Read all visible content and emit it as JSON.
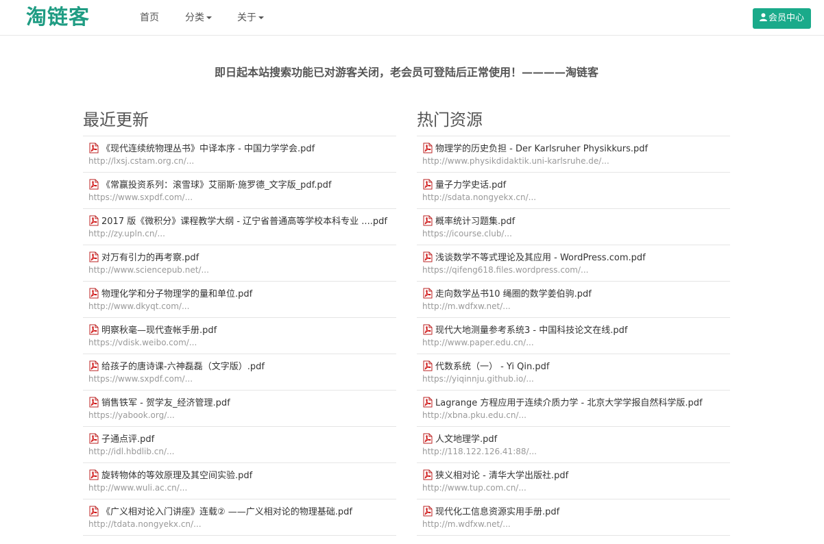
{
  "header": {
    "logo": "淘链客",
    "nav": [
      {
        "label": "首页",
        "dropdown": false
      },
      {
        "label": "分类",
        "dropdown": true
      },
      {
        "label": "关于",
        "dropdown": true
      }
    ],
    "member_button": "会员中心"
  },
  "notice": "即日起本站搜索功能已对游客关闭，老会员可登陆后正常使用！————淘链客",
  "colors": {
    "brand": "#1f9c83",
    "button": "#1aaa8a"
  },
  "recent": {
    "title": "最近更新",
    "items": [
      {
        "title": "《现代连续统物理丛书》中译本序 - 中国力学学会.pdf",
        "url": "http://lxsj.cstam.org.cn/..."
      },
      {
        "title": "《常赢投资系列：滚雪球》艾丽斯·施罗德_文字版_pdf.pdf",
        "url": "https://www.sxpdf.com/..."
      },
      {
        "title": "2017 版《微积分》课程教学大纲 - 辽宁省普通高等学校本科专业 ....pdf",
        "url": "http://zy.upln.cn/..."
      },
      {
        "title": "对万有引力的再考察.pdf",
        "url": "http://www.sciencepub.net/..."
      },
      {
        "title": "物理化学和分子物理学的量和单位.pdf",
        "url": "http://www.dkyqt.com/..."
      },
      {
        "title": "明察秋毫—现代查帐手册.pdf",
        "url": "https://vdisk.weibo.com/..."
      },
      {
        "title": "给孩子的唐诗课-六神磊磊（文字版）.pdf",
        "url": "https://www.sxpdf.com/..."
      },
      {
        "title": "销售铁军 - 贺学友_经济管理.pdf",
        "url": "https://yabook.org/..."
      },
      {
        "title": "子通点评.pdf",
        "url": "http://idl.hbdlib.cn/..."
      },
      {
        "title": "旋转物体的等效原理及其空间实验.pdf",
        "url": "http://www.wuli.ac.cn/..."
      },
      {
        "title": "《广义相对论入门讲座》连载② ——广义相对论的物理基础.pdf",
        "url": "http://tdata.nongyekx.cn/..."
      }
    ]
  },
  "popular": {
    "title": "热门资源",
    "items": [
      {
        "title": "物理学的历史负担 - Der Karlsruher Physikkurs.pdf",
        "url": "http://www.physikdidaktik.uni-karlsruhe.de/..."
      },
      {
        "title": "量子力学史话.pdf",
        "url": "http://sdata.nongyekx.cn/..."
      },
      {
        "title": "概率统计习题集.pdf",
        "url": "https://icourse.club/..."
      },
      {
        "title": "浅谈数学不等式理论及其应用 - WordPress.com.pdf",
        "url": "https://qifeng618.files.wordpress.com/..."
      },
      {
        "title": "走向数学丛书10 绳圈的数学姜伯驹.pdf",
        "url": "http://m.wdfxw.net/..."
      },
      {
        "title": "现代大地测量参考系统3 - 中国科技论文在线.pdf",
        "url": "http://www.paper.edu.cn/..."
      },
      {
        "title": "代数系统（一） - Yi Qin.pdf",
        "url": "https://yiqinnju.github.io/..."
      },
      {
        "title": "Lagrange 方程应用于连续介质力学 - 北京大学学报自然科学版.pdf",
        "url": "http://xbna.pku.edu.cn/..."
      },
      {
        "title": "人文地理学.pdf",
        "url": "http://118.122.126.41:88/..."
      },
      {
        "title": "狭义相对论 - 清华大学出版社.pdf",
        "url": "http://www.tup.com.cn/..."
      },
      {
        "title": "现代化工信息资源实用手册.pdf",
        "url": "http://m.wdfxw.net/..."
      }
    ]
  }
}
